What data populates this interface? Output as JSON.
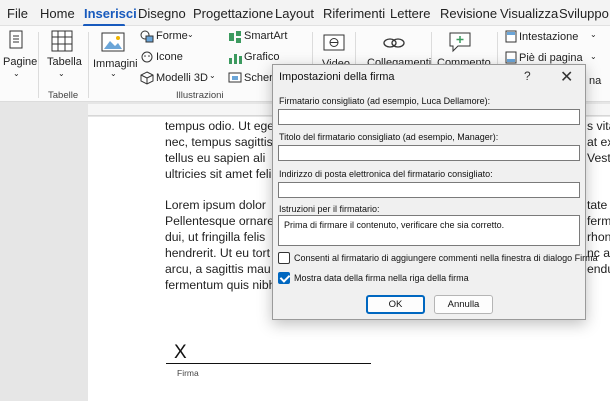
{
  "menu": {
    "items": [
      "File",
      "Home",
      "Inserisci",
      "Disegno",
      "Progettazione",
      "Layout",
      "Riferimenti",
      "Lettere",
      "Revisione",
      "Visualizza",
      "Sviluppo"
    ],
    "active": "Inserisci"
  },
  "ribbon": {
    "pagine": "Pagine",
    "tabella": "Tabella",
    "immagini": "Immagini",
    "forme": "Forme",
    "icone": "Icone",
    "modelli3d": "Modelli 3D",
    "smartart": "SmartArt",
    "grafico": "Grafico",
    "schermata": "Scherm",
    "video": "Video",
    "collegamenti": "Collegamenti",
    "commento": "Commento",
    "intestazione": "Intestazione",
    "piedipagina": "Piè di pagina",
    "numero": "na",
    "group_tabelle": "Tabelle",
    "group_illustrazioni": "Illustrazioni"
  },
  "document": {
    "lines_a": [
      "tempus odio. Ut eget",
      "nec, tempus sagittis",
      "tellus eu sapien ali",
      "ultricies sit amet feli"
    ],
    "lines_b": [
      "Lorem  ipsum  dolor",
      "Pellentesque ornare",
      "dui,  ut  fringilla  felis",
      "hendrerit. Ut eu tort",
      "arcu, a sagittis mau",
      "fermentum quis nibh"
    ],
    "lines_right": [
      "s vita",
      "at ex",
      "Vest",
      "",
      "tate",
      "ferm",
      "rhon",
      "nc a",
      "endu"
    ],
    "signature_x": "X",
    "signature_label": "Firma"
  },
  "dialog": {
    "title": "Impostazioni della firma",
    "help": "?",
    "close": "✕",
    "field1_label": "Firmatario consigliato (ad esempio, Luca Dellamore):",
    "field1_value": "",
    "field2_label": "Titolo del firmatario consigliato (ad esempio, Manager):",
    "field2_value": "",
    "field3_label": "Indirizzo di posta elettronica del firmatario consigliato:",
    "field3_value": "",
    "field4_label": "Istruzioni per il firmatario:",
    "field4_value": "Prima di firmare il contenuto, verificare che sia corretto.",
    "check1_label": "Consenti al firmatario di aggiungere commenti nella finestra di dialogo Firma",
    "check1_checked": false,
    "check2_label": "Mostra data della firma nella riga della firma",
    "check2_checked": true,
    "ok_label": "OK",
    "cancel_label": "Annulla"
  }
}
